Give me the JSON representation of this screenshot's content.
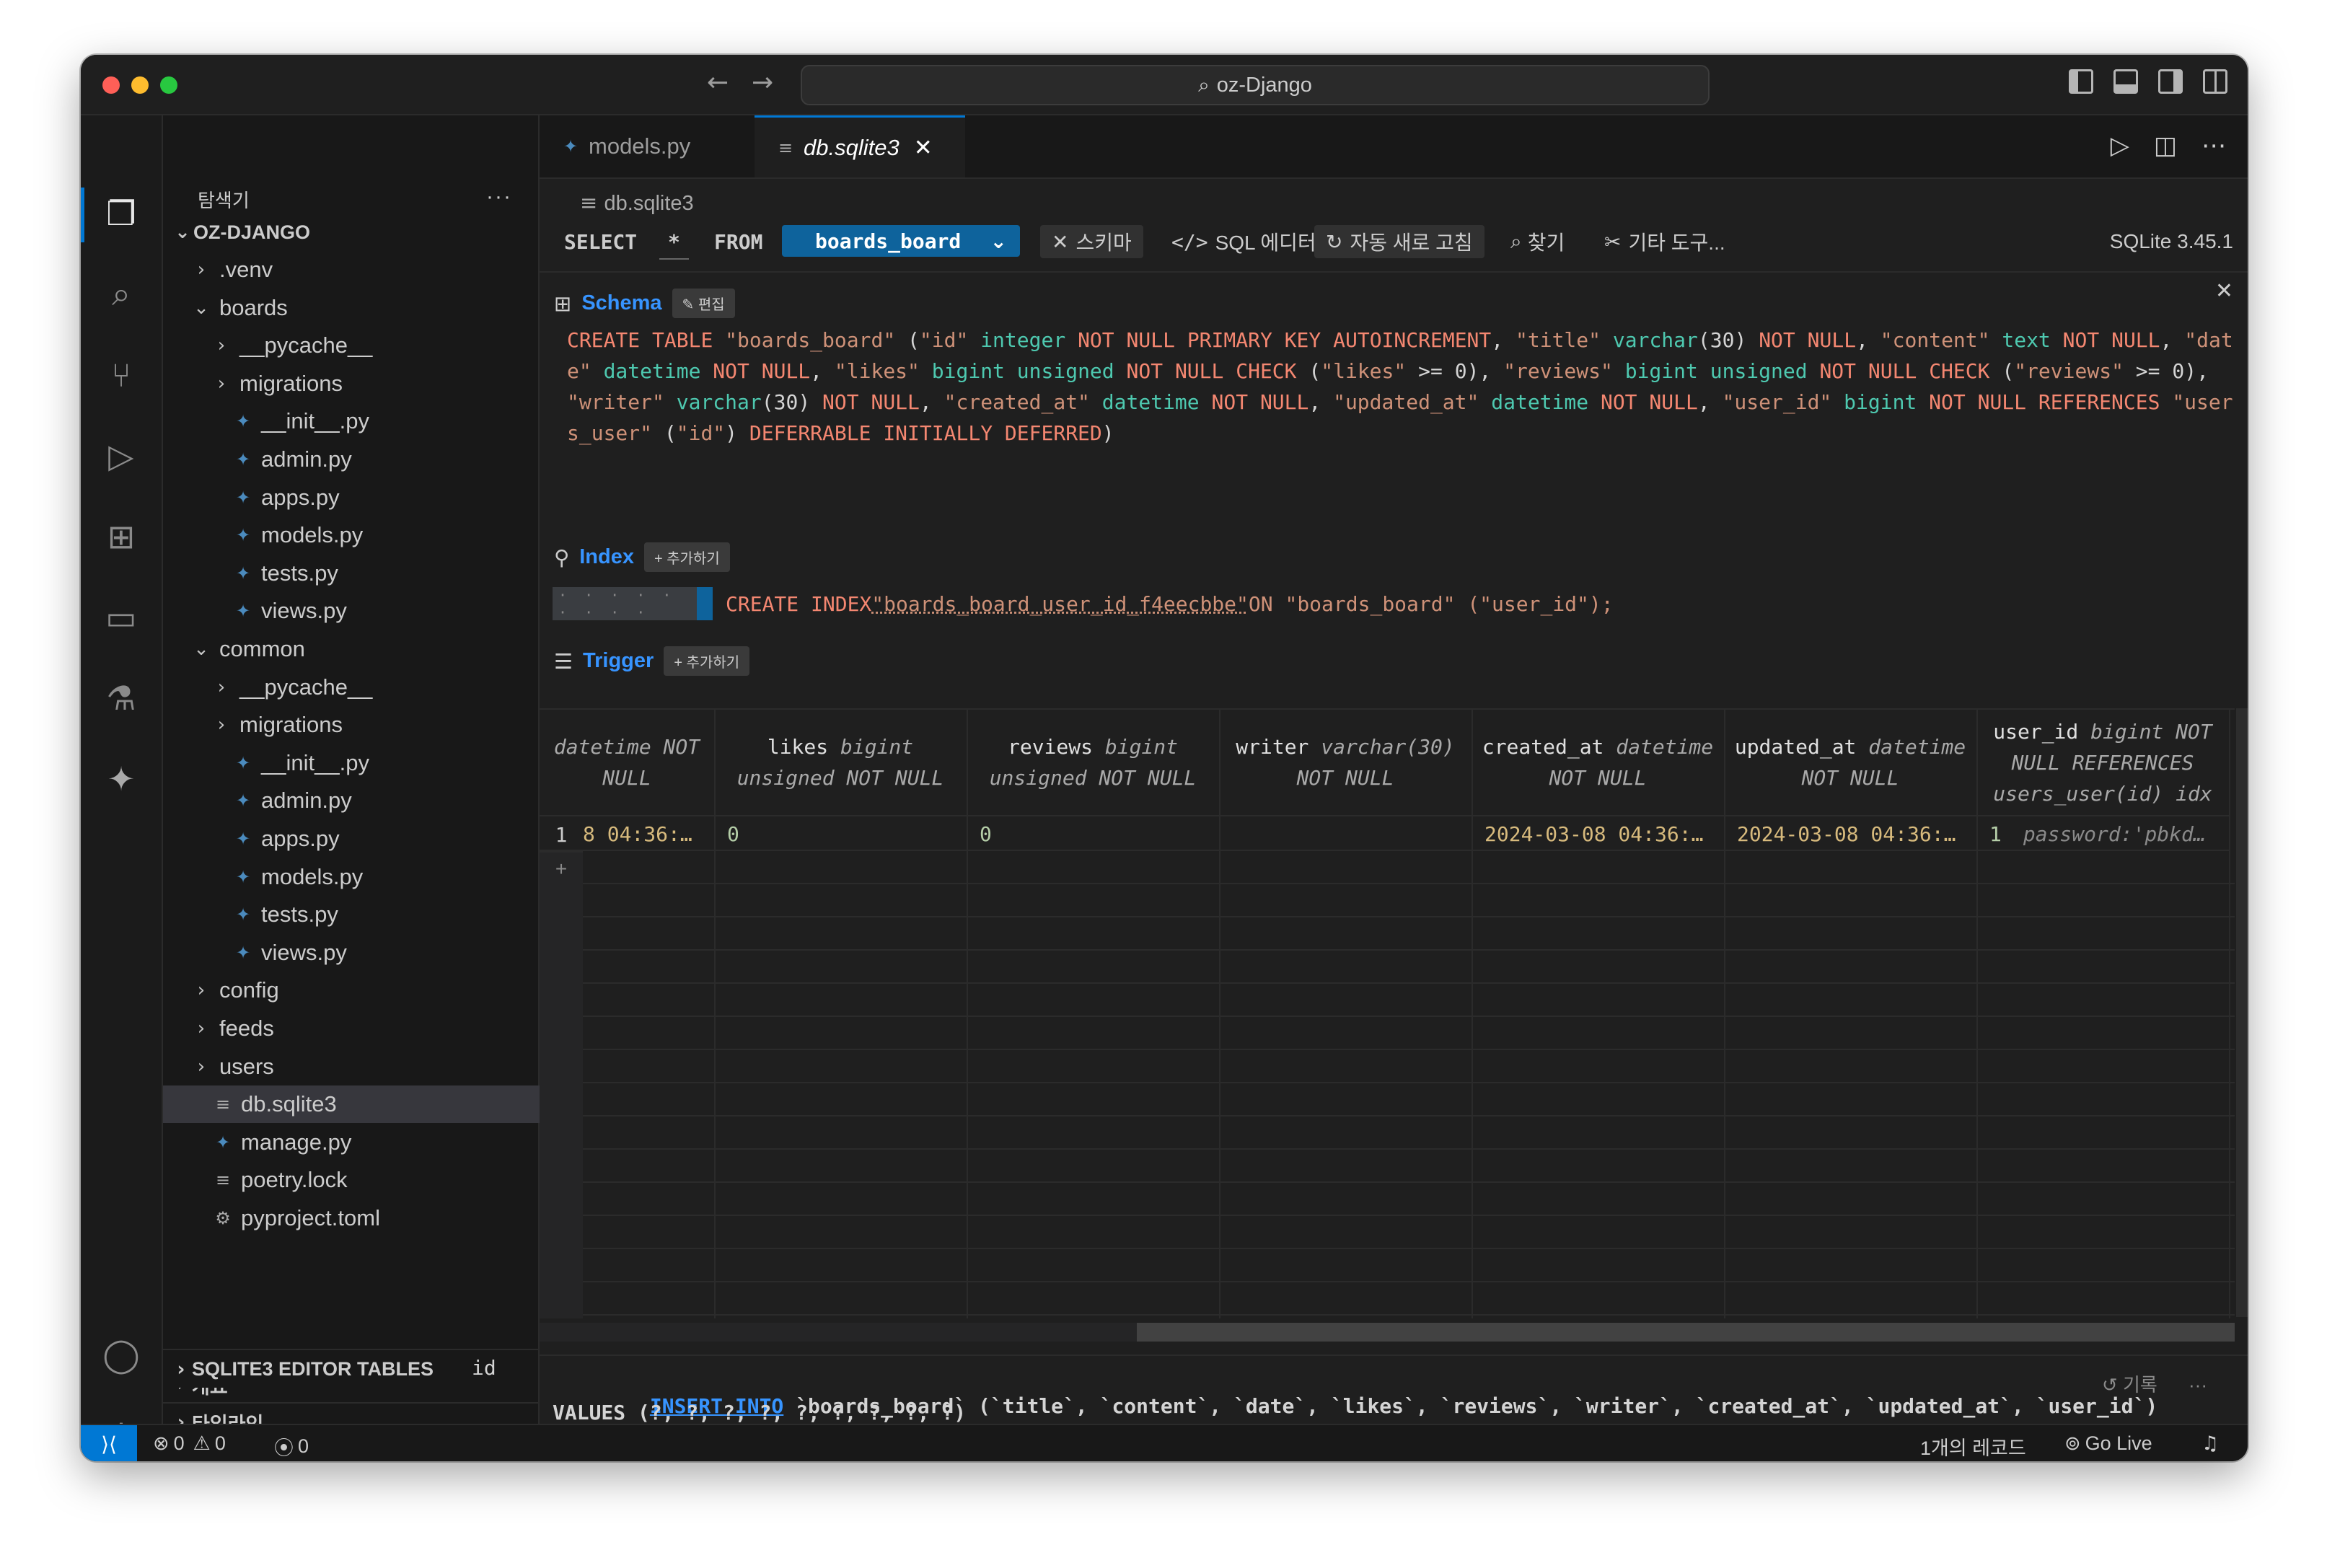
{
  "window": {
    "search_text": "oz-Django",
    "back_icon": "←",
    "forward_icon": "→"
  },
  "sidebar": {
    "title": "탐색기",
    "more": "···",
    "root": "OZ-DJANGO",
    "items": [
      {
        "label": ".venv",
        "chev": "›",
        "icon": "",
        "indent": 1
      },
      {
        "label": "boards",
        "chev": "⌄",
        "icon": "",
        "indent": 1
      },
      {
        "label": "__pycache__",
        "chev": "›",
        "icon": "",
        "indent": 2
      },
      {
        "label": "migrations",
        "chev": "›",
        "icon": "",
        "indent": 2
      },
      {
        "label": "__init__.py",
        "chev": "",
        "icon": "py",
        "indent": 2
      },
      {
        "label": "admin.py",
        "chev": "",
        "icon": "py",
        "indent": 2
      },
      {
        "label": "apps.py",
        "chev": "",
        "icon": "py",
        "indent": 2
      },
      {
        "label": "models.py",
        "chev": "",
        "icon": "py",
        "indent": 2
      },
      {
        "label": "tests.py",
        "chev": "",
        "icon": "py",
        "indent": 2
      },
      {
        "label": "views.py",
        "chev": "",
        "icon": "py",
        "indent": 2
      },
      {
        "label": "common",
        "chev": "⌄",
        "icon": "",
        "indent": 1
      },
      {
        "label": "__pycache__",
        "chev": "›",
        "icon": "",
        "indent": 2
      },
      {
        "label": "migrations",
        "chev": "›",
        "icon": "",
        "indent": 2
      },
      {
        "label": "__init__.py",
        "chev": "",
        "icon": "py",
        "indent": 2
      },
      {
        "label": "admin.py",
        "chev": "",
        "icon": "py",
        "indent": 2
      },
      {
        "label": "apps.py",
        "chev": "",
        "icon": "py",
        "indent": 2
      },
      {
        "label": "models.py",
        "chev": "",
        "icon": "py",
        "indent": 2
      },
      {
        "label": "tests.py",
        "chev": "",
        "icon": "py",
        "indent": 2
      },
      {
        "label": "views.py",
        "chev": "",
        "icon": "py",
        "indent": 2
      },
      {
        "label": "config",
        "chev": "›",
        "icon": "",
        "indent": 1
      },
      {
        "label": "feeds",
        "chev": "›",
        "icon": "",
        "indent": 1
      },
      {
        "label": "users",
        "chev": "›",
        "icon": "",
        "indent": 1
      },
      {
        "label": "db.sqlite3",
        "chev": "",
        "icon": "txt",
        "indent": 1,
        "selected": true
      },
      {
        "label": "manage.py",
        "chev": "",
        "icon": "py",
        "indent": 1
      },
      {
        "label": "poetry.lock",
        "chev": "",
        "icon": "txt",
        "indent": 1
      },
      {
        "label": "pyproject.toml",
        "chev": "",
        "icon": "cfg",
        "indent": 1
      }
    ],
    "sections": [
      "개요",
      "타임라인",
      "SQLITE3 EDITOR TABLES"
    ]
  },
  "tabs": [
    {
      "label": "models.py",
      "active": false
    },
    {
      "label": "db.sqlite3",
      "active": true
    }
  ],
  "breadcrumb": "db.sqlite3",
  "toolbar": {
    "select_kw": "SELECT",
    "star": "*",
    "from_kw": "FROM",
    "table": "boards_board",
    "schema_btn": "스키마",
    "sql_editor_btn": "SQL 에디터",
    "auto_refresh_btn": "자동 새로 고침",
    "find_btn": "찾기",
    "other_tools_btn": "기타 도구...",
    "version": "SQLite 3.45.1"
  },
  "schema": {
    "title": "Schema",
    "edit_btn": "편집",
    "ddl": "CREATE TABLE \"boards_board\" (\"id\" integer NOT NULL PRIMARY KEY AUTOINCREMENT, \"title\" varchar(30) NOT NULL, \"content\" text NOT NULL, \"date\" datetime NOT NULL, \"likes\" bigint unsigned NOT NULL CHECK (\"likes\" >= 0), \"reviews\" bigint unsigned NOT NULL CHECK (\"reviews\" >= 0), \"writer\" varchar(30) NOT NULL, \"created_at\" datetime NOT NULL, \"updated_at\" datetime NOT NULL, \"user_id\" bigint NOT NULL REFERENCES \"users_user\" (\"id\") DEFERRABLE INITIALLY DEFERRED)"
  },
  "index": {
    "title": "Index",
    "add_btn": "+ 추가하기",
    "dots": "· · · · · · · · ·",
    "stmt_prefix": "CREATE INDEX ",
    "name": "\"boards_board_user_id_f4eecbbe\"",
    "stmt_suffix": " ON \"boards_board\" (\"user_id\");"
  },
  "trigger": {
    "title": "Trigger",
    "add_btn": "+ 추가하기"
  },
  "grid": {
    "columns": [
      {
        "name": "",
        "type": "datetime NOT NULL"
      },
      {
        "name": "likes",
        "type": "bigint unsigned NOT NULL"
      },
      {
        "name": "reviews",
        "type": "bigint unsigned NOT NULL"
      },
      {
        "name": "writer",
        "type": "varchar(30) NOT NULL"
      },
      {
        "name": "created_at",
        "type": "datetime NOT NULL"
      },
      {
        "name": "updated_at",
        "type": "datetime NOT NULL"
      },
      {
        "name": "user_id",
        "type": "bigint NOT NULL REFERENCES users_user(id) idx"
      }
    ],
    "row": {
      "num": "1",
      "cells": [
        "8 04:36:…",
        "0",
        "0",
        "",
        "2024-03-08 04:36:…",
        "2024-03-08 04:36:…",
        "1"
      ],
      "extra": "password:'pbkd…"
    },
    "add_row": "+",
    "add_col": "+"
  },
  "sql": {
    "line1_kw": "INSERT INTO",
    "line1_rest": " `boards_board` (`title`, `content`, `date`, `likes`, `reviews`, `writer`, `created_at`, `updated_at`, `user_id`)",
    "line2": "VALUES (?, ?, ?, ?, ?, ?, ?, ?, ?)",
    "line3": "id",
    "history": "기록",
    "more": "···"
  },
  "status": {
    "errors": "0",
    "warnings": "0",
    "ports": "0",
    "records": "1개의 레코드",
    "go_live": "Go Live"
  }
}
